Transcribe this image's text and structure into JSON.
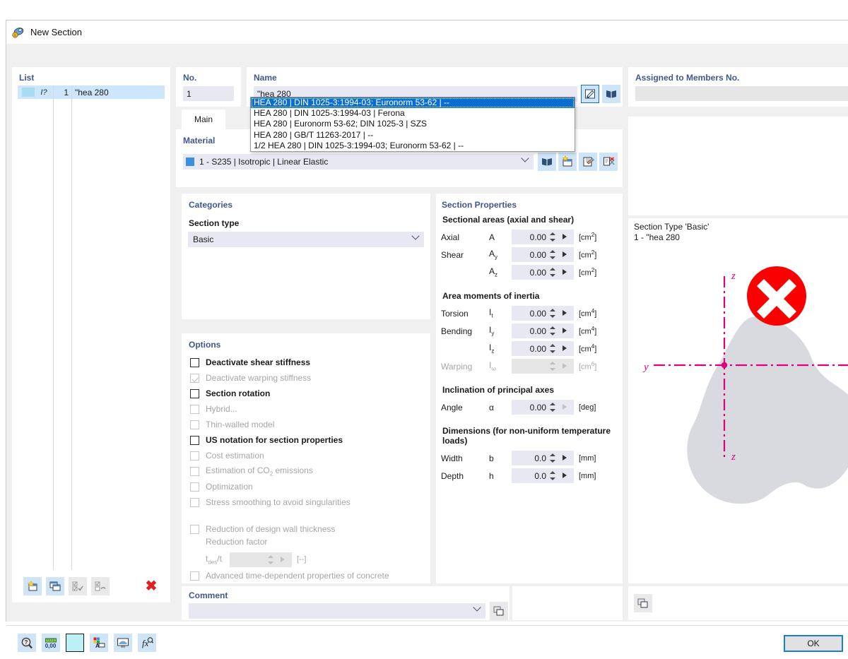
{
  "window": {
    "title": "New Section",
    "icon": "section-icon"
  },
  "list": {
    "header": "List",
    "rows": [
      {
        "glyph": "I?",
        "no": "1",
        "name": "\"hea 280"
      }
    ],
    "toolbar": [
      {
        "name": "new-section-button",
        "icon": "new-window-icon"
      },
      {
        "name": "copy-section-button",
        "icon": "copy-window-icon"
      },
      {
        "name": "check-all-button",
        "icon": "checklist-icon"
      },
      {
        "name": "uncheck-all-button",
        "icon": "checklist-clear-icon"
      }
    ],
    "delete_button": {
      "name": "delete-section-button",
      "icon": "red-x-icon",
      "glyph": "✖"
    }
  },
  "number": {
    "label": "No.",
    "value": "1"
  },
  "name": {
    "label": "Name",
    "value": "\"hea 280",
    "edit_button": "edit-icon",
    "library_button": "library-icon"
  },
  "name_dropdown": {
    "selected_index": 0,
    "items": [
      "HEA 280 | DIN 1025-3:1994-03; Euronorm 53-62 | --",
      "HEA 280 | DIN 1025-3:1994-03 | Ferona",
      "HEA 280 | Euronorm 53-62; DIN 1025-3 | SZS",
      "HEA 280 | GB/T 11263-2017 | --",
      "1/2 HEA 280 | DIN 1025-3:1994-03; Euronorm 53-62 | --"
    ]
  },
  "tabs": [
    {
      "label": "Main",
      "active": true
    }
  ],
  "material": {
    "label": "Material",
    "value": "1 - S235 | Isotropic | Linear Elastic",
    "swatch_color": "#3c8ee0",
    "buttons": [
      {
        "name": "material-library-button",
        "icon": "library-icon"
      },
      {
        "name": "material-new-button",
        "icon": "new-doc-icon"
      },
      {
        "name": "material-edit-button",
        "icon": "edit-doc-icon"
      },
      {
        "name": "material-delete-button",
        "icon": "delete-doc-icon"
      }
    ]
  },
  "categories": {
    "title": "Categories",
    "section_type_label": "Section type",
    "section_type_value": "Basic"
  },
  "options": {
    "title": "Options",
    "items": [
      {
        "label": "Deactivate shear stiffness",
        "checked": false,
        "enabled": true
      },
      {
        "label": "Deactivate warping stiffness",
        "checked": true,
        "enabled": false
      },
      {
        "label": "Section rotation",
        "checked": false,
        "enabled": true
      },
      {
        "label": "Hybrid...",
        "checked": false,
        "enabled": false
      },
      {
        "label": "Thin-walled model",
        "checked": false,
        "enabled": false
      },
      {
        "label": "US notation for section properties",
        "checked": false,
        "enabled": true
      },
      {
        "label": "Cost estimation",
        "checked": false,
        "enabled": false
      },
      {
        "label": "Estimation of CO2 emissions",
        "checked": false,
        "enabled": false
      },
      {
        "label": "Optimization",
        "checked": false,
        "enabled": false
      },
      {
        "label": "Stress smoothing to avoid singularities",
        "checked": false,
        "enabled": false
      }
    ],
    "reduction": {
      "checkbox_label": "Reduction of design wall thickness",
      "factor_label": "Reduction factor",
      "symbol": "tdes/t",
      "value": "",
      "unit": "[--]"
    },
    "advanced_concrete": {
      "label": "Advanced time-dependent properties of concrete",
      "checked": false,
      "enabled": false
    }
  },
  "properties": {
    "title": "Section Properties",
    "groups": [
      {
        "heading": "Sectional areas (axial and shear)",
        "rows": [
          {
            "label": "Axial",
            "symbol": "A",
            "sub": "",
            "value": "0.00",
            "unit": "cm",
            "exp": "2",
            "enabled": true
          },
          {
            "label": "Shear",
            "symbol": "A",
            "sub": "y",
            "value": "0.00",
            "unit": "cm",
            "exp": "2",
            "enabled": true
          },
          {
            "label": "",
            "symbol": "A",
            "sub": "z",
            "value": "0.00",
            "unit": "cm",
            "exp": "2",
            "enabled": true
          }
        ]
      },
      {
        "heading": "Area moments of inertia",
        "rows": [
          {
            "label": "Torsion",
            "symbol": "I",
            "sub": "t",
            "value": "0.00",
            "unit": "cm",
            "exp": "4",
            "enabled": true
          },
          {
            "label": "Bending",
            "symbol": "I",
            "sub": "y",
            "value": "0.00",
            "unit": "cm",
            "exp": "4",
            "enabled": true
          },
          {
            "label": "",
            "symbol": "I",
            "sub": "z",
            "value": "0.00",
            "unit": "cm",
            "exp": "4",
            "enabled": true
          },
          {
            "label": "Warping",
            "symbol": "I",
            "sub": "ω",
            "value": "",
            "unit": "cm",
            "exp": "6",
            "enabled": false
          }
        ]
      },
      {
        "heading": "Inclination of principal axes",
        "rows": [
          {
            "label": "Angle",
            "symbol": "α",
            "sub": "",
            "value": "0.00",
            "unit": "deg",
            "exp": "",
            "enabled": true,
            "no_spin": true
          }
        ]
      },
      {
        "heading": "Dimensions (for non-uniform temperature loads)",
        "rows": [
          {
            "label": "Width",
            "symbol": "b",
            "sub": "",
            "value": "0.0",
            "unit": "mm",
            "exp": "",
            "enabled": true
          },
          {
            "label": "Depth",
            "symbol": "h",
            "sub": "",
            "value": "0.0",
            "unit": "mm",
            "exp": "",
            "enabled": true
          }
        ]
      }
    ]
  },
  "assigned": {
    "label": "Assigned to Members No.",
    "value": ""
  },
  "preview": {
    "type_line": "Section Type 'Basic'",
    "name_line": "1 - \"hea 280",
    "axis_y": "y",
    "axis_z_top": "z",
    "axis_z_bottom": "z",
    "axis_color": "#e2007a",
    "shape_color": "#d9d9e0",
    "error_color": "#fa0000",
    "error_icon": "error-x-icon"
  },
  "comment": {
    "label": "Comment",
    "value": "",
    "button": "comment-copy-icon"
  },
  "bottom_toolbar": [
    {
      "name": "help-button",
      "icon": "help-magnifier-icon"
    },
    {
      "name": "units-button",
      "icon": "units-ruler-icon"
    },
    {
      "name": "color-button",
      "icon": "color-swatch-icon"
    },
    {
      "name": "display-properties-button",
      "icon": "display-props-icon"
    },
    {
      "name": "view-button",
      "icon": "view-icon"
    },
    {
      "name": "formula-button",
      "icon": "formula-fx-icon"
    }
  ],
  "ok_button": {
    "label": "OK"
  }
}
